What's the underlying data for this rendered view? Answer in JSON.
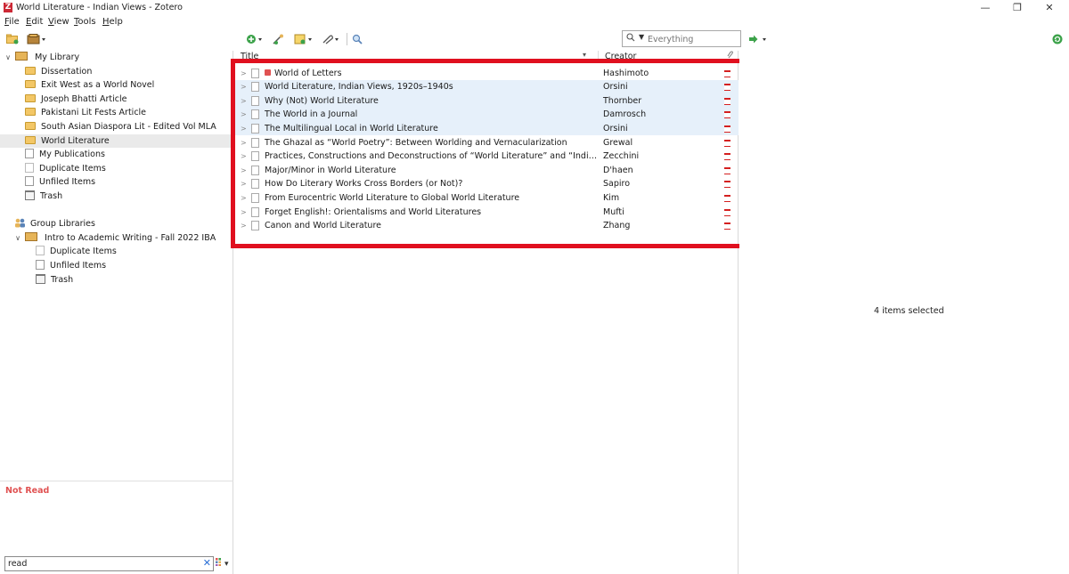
{
  "window": {
    "title": "World Literature - Indian Views - Zotero",
    "logo_letter": "Z",
    "minimize": "—",
    "maximize": "❐",
    "close": "✕"
  },
  "menu": {
    "items": [
      {
        "underline": "F",
        "rest": "ile"
      },
      {
        "underline": "E",
        "rest": "dit"
      },
      {
        "underline": "V",
        "rest": "iew"
      },
      {
        "underline": "T",
        "rest": "ools"
      },
      {
        "underline": "H",
        "rest": "elp"
      }
    ]
  },
  "toolbar": {
    "new_collection_icon": "new-collection-icon",
    "new_library_icon": "new-library-icon",
    "new_item_icon": "new-item-icon",
    "add_by_identifier_icon": "magic-wand-icon",
    "new_note_icon": "new-note-icon",
    "attachment_icon": "paperclip-icon",
    "advanced_search_icon": "magnifier-icon",
    "locate_icon": "green-arrow-icon",
    "sync_icon": "sync-icon",
    "search_placeholder": "Everything"
  },
  "collections": {
    "my_library": "My Library",
    "items": [
      {
        "label": "Dissertation",
        "type": "folder"
      },
      {
        "label": "Exit West as a World Novel",
        "type": "folder"
      },
      {
        "label": "Joseph Bhatti Article",
        "type": "folder"
      },
      {
        "label": "Pakistani Lit Fests Article",
        "type": "folder"
      },
      {
        "label": "South Asian Diaspora Lit - Edited Vol MLA",
        "type": "folder"
      },
      {
        "label": "World Literature",
        "type": "folder",
        "selected": true
      },
      {
        "label": "My Publications",
        "type": "doc"
      },
      {
        "label": "Duplicate Items",
        "type": "duplicate"
      },
      {
        "label": "Unfiled Items",
        "type": "doc"
      },
      {
        "label": "Trash",
        "type": "trash"
      }
    ],
    "group_libraries": "Group Libraries",
    "group": {
      "label": "Intro to Academic Writing - Fall 2022 IBA",
      "items": [
        {
          "label": "Duplicate Items",
          "type": "duplicate"
        },
        {
          "label": "Unfiled Items",
          "type": "doc"
        },
        {
          "label": "Trash",
          "type": "trash"
        }
      ]
    }
  },
  "tags": {
    "not_read": "Not Read",
    "filter_value": "read",
    "clear": "✕",
    "menu": "▾"
  },
  "columns": {
    "title": "Title",
    "creator": "Creator",
    "sort_arrow": "▾",
    "attachment_icon": "paperclip-icon"
  },
  "items": [
    {
      "title": "World of Letters",
      "creator": "Hashimoto",
      "selected": false,
      "tag": "Not Read"
    },
    {
      "title": "World Literature, Indian Views, 1920s–1940s",
      "creator": "Orsini",
      "selected": true
    },
    {
      "title": "Why (Not) World Literature",
      "creator": "Thornber",
      "selected": true
    },
    {
      "title": "The World in a Journal",
      "creator": "Damrosch",
      "selected": true
    },
    {
      "title": "The Multilingual Local in World Literature",
      "creator": "Orsini",
      "selected": true
    },
    {
      "title": "The Ghazal as “World Poetry”: Between Worlding and Vernacularization",
      "creator": "Grewal",
      "selected": false
    },
    {
      "title": "Practices, Constructions and Deconstructions of “World Literature” and “Indian Literature...",
      "creator": "Zecchini",
      "selected": false
    },
    {
      "title": "Major/Minor in World Literature",
      "creator": "D'haen",
      "selected": false
    },
    {
      "title": "How Do Literary Works Cross Borders (or Not)?",
      "creator": "Sapiro",
      "selected": false
    },
    {
      "title": "From Eurocentric World Literature to Global World Literature",
      "creator": "Kim",
      "selected": false
    },
    {
      "title": "Forget English!: Orientalisms and World Literatures",
      "creator": "Mufti",
      "selected": false
    },
    {
      "title": "Canon and World Literature",
      "creator": "Zhang",
      "selected": false
    }
  ],
  "right_pane": {
    "status": "4 items selected"
  },
  "colors": {
    "highlight_border": "#e0101f",
    "selection": "#e6f0fa",
    "tag_red": "#e05252"
  }
}
